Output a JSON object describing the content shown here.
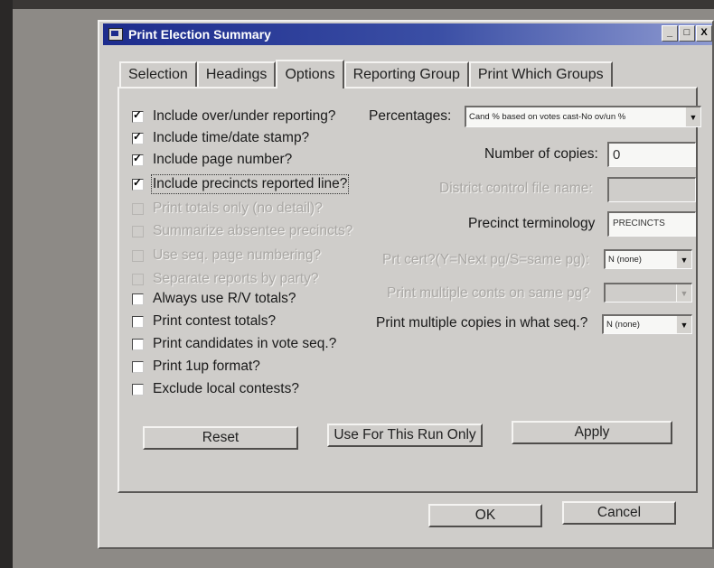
{
  "window": {
    "title": "Print Election Summary"
  },
  "title_buttons": [
    {
      "label": "_",
      "name": "minimize-button"
    },
    {
      "label": "□",
      "name": "maximize-button"
    },
    {
      "label": "X",
      "name": "close-button"
    }
  ],
  "tabs": [
    {
      "label": "Selection",
      "active": false
    },
    {
      "label": "Headings",
      "active": false
    },
    {
      "label": "Options",
      "active": true
    },
    {
      "label": "Reporting Group",
      "active": false
    },
    {
      "label": "Print Which Groups",
      "active": false
    }
  ],
  "checkboxes": [
    {
      "label": "Include over/under reporting?",
      "checked": true,
      "enabled": true
    },
    {
      "label": "Include time/date stamp?",
      "checked": true,
      "enabled": true
    },
    {
      "label": "Include page number?",
      "checked": true,
      "enabled": true
    },
    {
      "label": "Include precincts reported line?",
      "checked": true,
      "enabled": true,
      "focused": true
    },
    {
      "label": "Print totals only (no detail)?",
      "checked": false,
      "enabled": false
    },
    {
      "label": "Summarize absentee precincts?",
      "checked": false,
      "enabled": false
    },
    {
      "label": "Use seq. page numbering?",
      "checked": false,
      "enabled": false
    },
    {
      "label": "Separate reports by party?",
      "checked": false,
      "enabled": false
    },
    {
      "label": "Always use R/V totals?",
      "checked": false,
      "enabled": true
    },
    {
      "label": "Print contest totals?",
      "checked": false,
      "enabled": true
    },
    {
      "label": "Print candidates in vote seq.?",
      "checked": false,
      "enabled": true
    },
    {
      "label": "Print 1up format?",
      "checked": false,
      "enabled": true
    },
    {
      "label": "Exclude local contests?",
      "checked": false,
      "enabled": true
    }
  ],
  "right": {
    "percentages_label": "Percentages:",
    "percentages_value": "Cand % based on votes cast-No ov/un %",
    "copies_label": "Number of copies:",
    "copies_value": "0",
    "district_label": "District control file name:",
    "district_value": "",
    "terminology_label": "Precinct terminology",
    "terminology_value": "PRECINCTS",
    "prt_cert_label": "Prt cert?(Y=Next pg/S=same pg):",
    "prt_cert_value": "N (none)",
    "multi_conts_label": "Print multiple conts on same pg?",
    "multi_conts_value": "",
    "copies_seq_label": "Print multiple copies in what seq.?",
    "copies_seq_value": "N (none)"
  },
  "buttons": {
    "reset": "Reset",
    "use_run": "Use For This Run Only",
    "apply": "Apply",
    "ok": "OK",
    "cancel": "Cancel"
  }
}
